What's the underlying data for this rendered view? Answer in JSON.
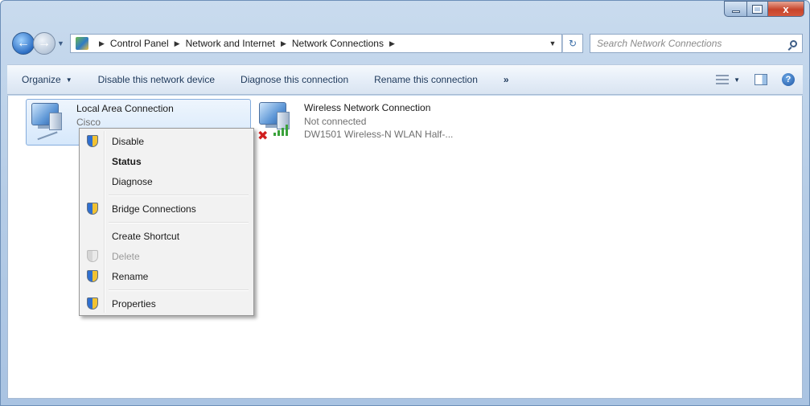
{
  "window": {
    "caption_buttons": {
      "close_glyph": "x"
    }
  },
  "navigation": {
    "back_icon": "back-arrow-icon",
    "forward_icon": "forward-arrow-icon",
    "breadcrumbs": [
      "Control Panel",
      "Network and Internet",
      "Network Connections"
    ],
    "search_placeholder": "Search Network Connections"
  },
  "commandbar": {
    "organize": "Organize",
    "disable": "Disable this network device",
    "diagnose": "Diagnose this connection",
    "rename": "Rename this connection",
    "more": "»"
  },
  "connections": [
    {
      "title": "Local Area Connection",
      "subtitle": "Cisco",
      "selected": true
    },
    {
      "title": "Wireless Network Connection",
      "status": "Not connected",
      "device": "DW1501 Wireless-N WLAN Half-..."
    }
  ],
  "context_menu": {
    "items": [
      {
        "label": "Disable",
        "shield": true
      },
      {
        "label": "Status",
        "bold": true
      },
      {
        "label": "Diagnose"
      },
      {
        "label": "Bridge Connections",
        "shield": true
      },
      {
        "label": "Create Shortcut"
      },
      {
        "label": "Delete",
        "shield": true,
        "disabled": true
      },
      {
        "label": "Rename",
        "shield": true
      },
      {
        "label": "Properties",
        "shield": true
      }
    ]
  },
  "colors": {
    "titlebar": "#b5cce6",
    "selection": "#d6e8fb",
    "close_button": "#c7442b",
    "wireless_bars": "#3aa23a",
    "disconnected_x": "#d01f1f"
  }
}
